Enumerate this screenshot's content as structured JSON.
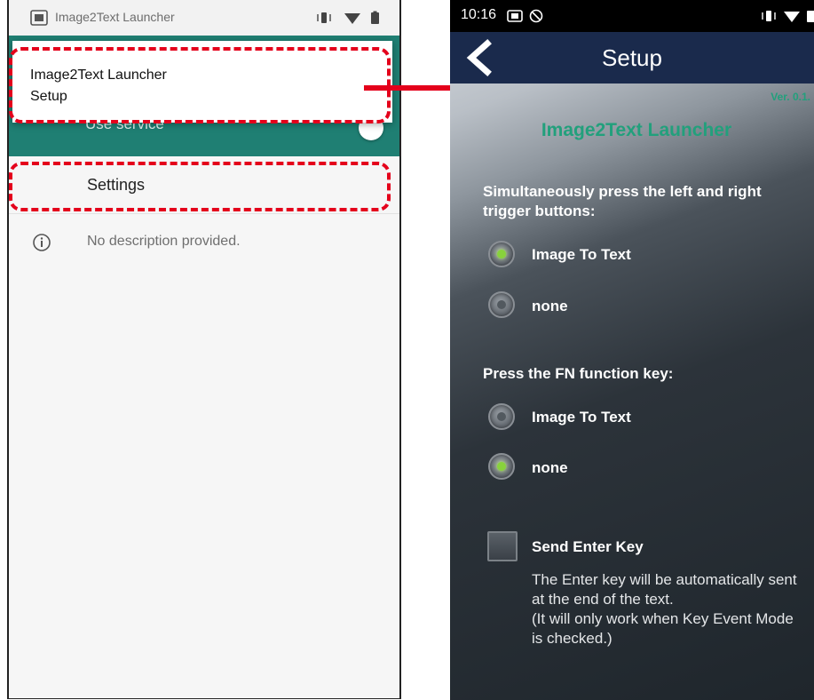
{
  "left": {
    "status_app_name": "Image2Text Launcher",
    "popup_title": "Image2Text Launcher",
    "popup_subtitle": "Setup",
    "use_service_label": "Use service",
    "settings_label": "Settings",
    "description": "No description provided."
  },
  "right": {
    "time": "10:16",
    "header_title": "Setup",
    "version": "Ver. 0.1.",
    "app_title": "Image2Text Launcher",
    "section1": "Simultaneously press the left and right trigger buttons:",
    "section1_options": [
      {
        "label": "Image To Text",
        "selected": true
      },
      {
        "label": "none",
        "selected": false
      }
    ],
    "section2": "Press the FN function key:",
    "section2_options": [
      {
        "label": "Image To Text",
        "selected": false
      },
      {
        "label": "none",
        "selected": true
      }
    ],
    "send_enter_label": "Send Enter Key",
    "send_enter_checked": false,
    "send_enter_desc": "The Enter key will be automatically sent at the end of the text.\n(It will only work when Key Event Mode is checked.)"
  },
  "colors": {
    "highlight": "#e4001b",
    "teal": "#1f7f73",
    "header_navy": "#1a2a4c",
    "accent_green": "#22a07c",
    "radio_selected": "#88d23c"
  },
  "icons": [
    "app-icon",
    "vibrate-icon",
    "wifi-icon",
    "battery-icon",
    "info-icon",
    "back-chevron-icon"
  ]
}
